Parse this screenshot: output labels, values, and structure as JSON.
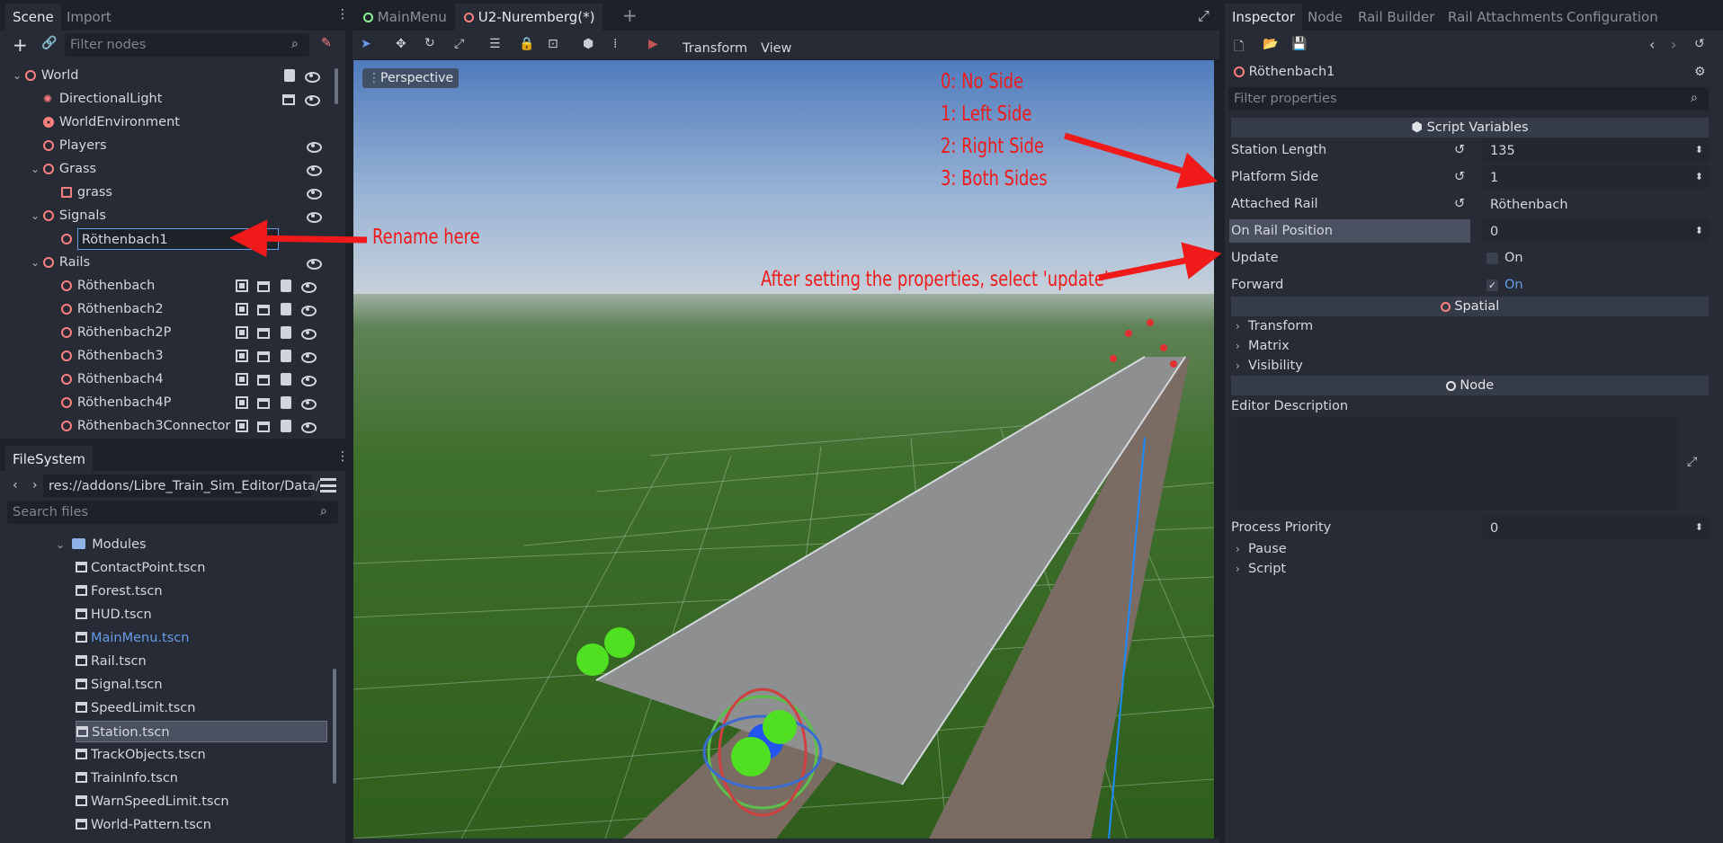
{
  "scene_dock": {
    "tabs": [
      "Scene",
      "Import"
    ],
    "filter_placeholder": "Filter nodes",
    "tree": [
      {
        "label": "World",
        "indent": 0,
        "arrow": "⌄"
      },
      {
        "label": "DirectionalLight",
        "indent": 1
      },
      {
        "label": "WorldEnvironment",
        "indent": 1
      },
      {
        "label": "Players",
        "indent": 1
      },
      {
        "label": "Grass",
        "indent": 1,
        "arrow": "⌄"
      },
      {
        "label": "grass",
        "indent": 2
      },
      {
        "label": "Signals",
        "indent": 1,
        "arrow": "⌄"
      },
      {
        "label": "Röthenbach1",
        "indent": 2,
        "editing": true
      },
      {
        "label": "Rails",
        "indent": 1,
        "arrow": "⌄"
      },
      {
        "label": "Röthenbach",
        "indent": 2
      },
      {
        "label": "Röthenbach2",
        "indent": 2
      },
      {
        "label": "Röthenbach2P",
        "indent": 2
      },
      {
        "label": "Röthenbach3",
        "indent": 2
      },
      {
        "label": "Röthenbach4",
        "indent": 2
      },
      {
        "label": "Röthenbach4P",
        "indent": 2
      },
      {
        "label": "Röthenbach3Connector",
        "indent": 2
      }
    ]
  },
  "filesystem": {
    "tab": "FileSystem",
    "path": "res://addons/Libre_Train_Sim_Editor/Data/",
    "search_placeholder": "Search files",
    "folder": "Modules",
    "files": [
      "ContactPoint.tscn",
      "Forest.tscn",
      "HUD.tscn",
      "MainMenu.tscn",
      "Rail.tscn",
      "Signal.tscn",
      "SpeedLimit.tscn",
      "Station.tscn",
      "TrackObjects.tscn",
      "TrainInfo.tscn",
      "WarnSpeedLimit.tscn",
      "World-Pattern.tscn"
    ],
    "selected": "Station.tscn",
    "highlight": "MainMenu.tscn"
  },
  "editor": {
    "tabs": [
      "MainMenu",
      "U2-Nuremberg(*)"
    ],
    "add_tab": "+",
    "menus": [
      "Transform",
      "View"
    ],
    "perspective": "Perspective"
  },
  "annotations": {
    "legend": [
      "0: No Side",
      "1: Left Side",
      "2: Right Side",
      "3: Both Sides"
    ],
    "rename": "Rename here",
    "update": "After setting the properties, select 'update'"
  },
  "inspector": {
    "tabs": [
      "Inspector",
      "Node",
      "Rail Builder",
      "Rail Attachments",
      "Configuration"
    ],
    "node_name": "Röthenbach1",
    "filter_placeholder": "Filter properties",
    "script_section": "Script Variables",
    "props": {
      "station_length": {
        "label": "Station Length",
        "value": "135"
      },
      "platform_side": {
        "label": "Platform Side",
        "value": "1"
      },
      "attached_rail": {
        "label": "Attached Rail",
        "value": "Röthenbach"
      },
      "on_rail_position": {
        "label": "On Rail Position",
        "value": "0"
      },
      "update": {
        "label": "Update",
        "value": "On"
      },
      "forward": {
        "label": "Forward",
        "value": "On"
      }
    },
    "spatial_section": "Spatial",
    "spatial_groups": [
      "Transform",
      "Matrix",
      "Visibility"
    ],
    "node_section": "Node",
    "editor_description": "Editor Description",
    "process_priority": {
      "label": "Process Priority",
      "value": "0"
    },
    "node_groups": [
      "Pause",
      "Script"
    ]
  },
  "colors": {
    "accent": "#699ce8",
    "annotation": "#f01a1a",
    "node_icon": "#fc7f7f"
  }
}
